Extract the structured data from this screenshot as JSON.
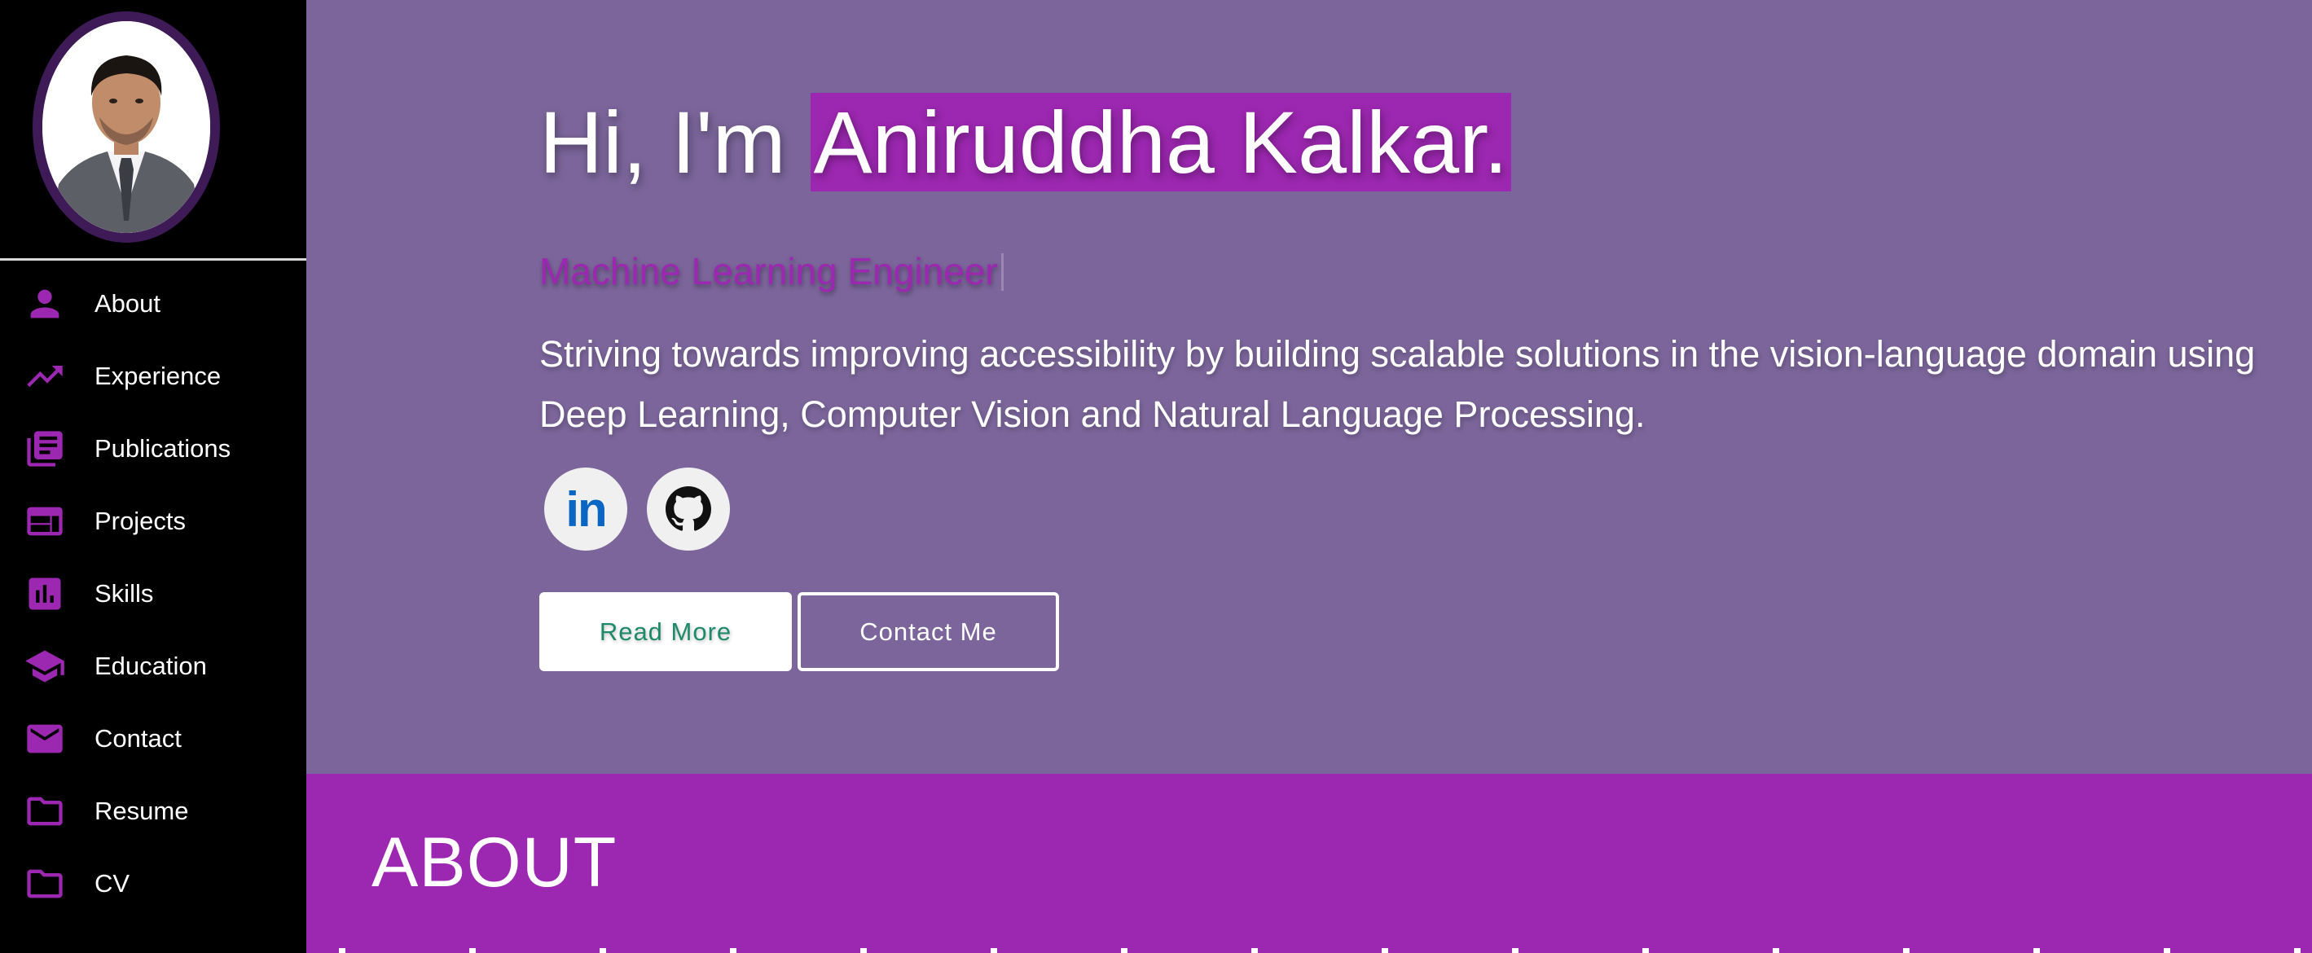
{
  "sidebar": {
    "items": [
      {
        "label": "About",
        "icon": "person-icon"
      },
      {
        "label": "Experience",
        "icon": "trending-up-icon"
      },
      {
        "label": "Publications",
        "icon": "library-books-icon"
      },
      {
        "label": "Projects",
        "icon": "web-icon"
      },
      {
        "label": "Skills",
        "icon": "bar-chart-icon"
      },
      {
        "label": "Education",
        "icon": "school-icon"
      },
      {
        "label": "Contact",
        "icon": "mail-icon"
      },
      {
        "label": "Resume",
        "icon": "folder-icon"
      },
      {
        "label": "CV",
        "icon": "folder-icon"
      }
    ]
  },
  "hero": {
    "greeting": "Hi, I'm ",
    "name": "Aniruddha Kalkar.",
    "subtitle": "Machine Learning Engineer",
    "description": "Striving towards improving accessibility by building scalable solutions in the vision-language domain using Deep Learning, Computer Vision and Natural Language Processing.",
    "social": [
      {
        "name": "LinkedIn",
        "icon": "linkedin-icon",
        "glyph": "in"
      },
      {
        "name": "GitHub",
        "icon": "github-icon"
      }
    ],
    "read_more_label": "Read More",
    "contact_me_label": "Contact Me"
  },
  "about": {
    "title": "ABOUT"
  },
  "colors": {
    "accent": "#9c27b0",
    "hero_background": "#7b659a",
    "sidebar_background": "#000000",
    "avatar_ring": "#3e1a57",
    "linkedin_blue": "#0a66c2",
    "read_more_text": "#1e8a6a"
  }
}
